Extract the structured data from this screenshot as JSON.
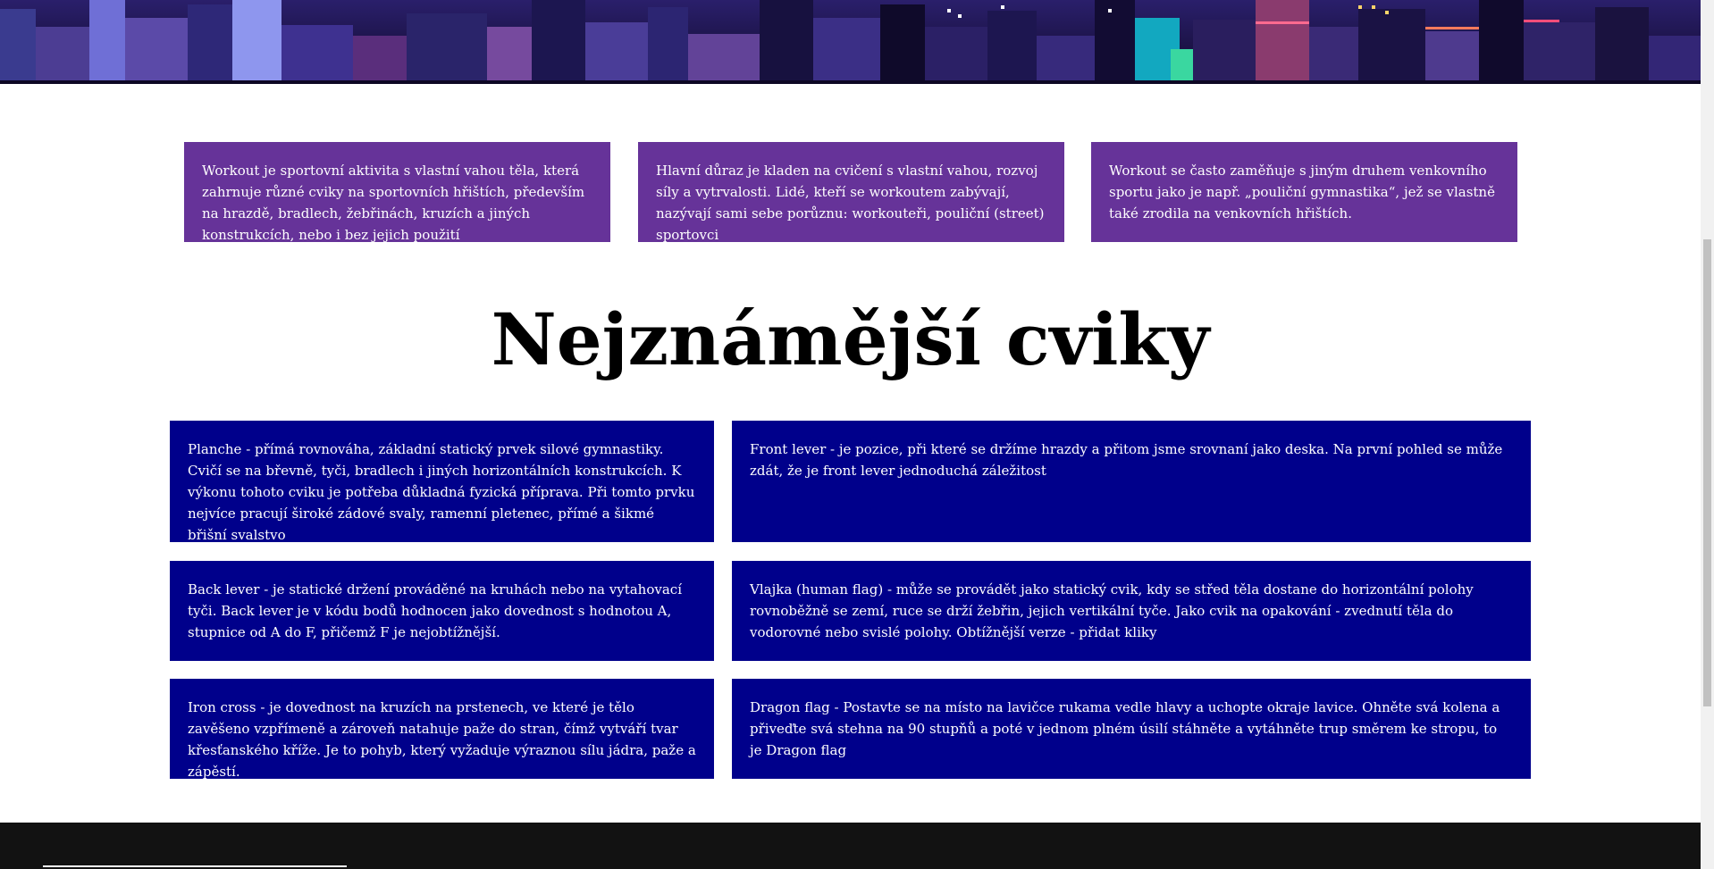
{
  "intro_cards": [
    {
      "text": "Workout je sportovní aktivita s vlastní vahou těla, která zahrnuje různé cviky na sportovních hřištích, především na hrazdě, bradlech, žebřinách, kruzích a jiných konstrukcích, nebo i bez jejich použití"
    },
    {
      "text": "Hlavní důraz je kladen na cvičení s vlastní vahou, rozvoj síly a vytrvalosti. Lidé, kteří se workoutem zabývají, nazývají sami sebe porůznu: workouteři, pouliční (street) sportovci"
    },
    {
      "text": "Workout se často zaměňuje s jiným druhem venkovního sportu jako je např. „pouliční gymnastika“, jež se vlastně také zrodila na venkovních hřištích."
    }
  ],
  "heading": "Nejznámější cviky",
  "exercises": [
    {
      "text": "Planche - přímá rovnováha, základní statický prvek silové gymnastiky. Cvičí se na břevně, tyči, bradlech i jiných horizontálních konstrukcích. K výkonu tohoto cviku je potřeba důkladná fyzická příprava. Při tomto prvku nejvíce pracují široké zádové svaly, ramenní pletenec, přímé a šikmé břišní svalstvo"
    },
    {
      "text": "Front lever - je pozice, při které se držíme hrazdy a přitom jsme srovnaní jako deska. Na první pohled se může zdát, že je front lever jednoduchá záležitost"
    },
    {
      "text": "Back lever - je statické držení prováděné na kruhách nebo na vytahovací tyči. Back lever je v kódu bodů hodnocen jako dovednost s hodnotou A, stupnice od A do F, přičemž F je nejobtížnější."
    },
    {
      "text": "Vlajka (human flag) - může se provádět jako statický cvik, kdy se střed těla dostane do horizontální polohy rovnoběžně se zemí, ruce se drží žebřin, jejich vertikální tyče. Jako cvik na opakování - zvednutí těla do vodorovné nebo svislé polohy. Obtížnější verze - přidat kliky"
    },
    {
      "text": "Iron cross - je dovednost na kruzích na prstenech, ve které je tělo zavěšeno vzpřímeně a zároveň natahuje paže do stran, čímž vytváří tvar křesťanského kříže. Je to pohyb, který vyžaduje výraznou sílu jádra, paže a zápěstí."
    },
    {
      "text": "Dragon flag - Postavte se na místo na lavičce rukama vedle hlavy a uchopte okraje lavice. Ohněte svá kolena a přiveďte svá stehna na 90 stupňů a poté v jednom plném úsilí stáhněte a vytáhněte trup směrem ke stropu, to je Dragon flag"
    }
  ],
  "colors": {
    "intro_card_bg": "#663399",
    "exercise_card_bg": "#00008b",
    "footer_bg": "#121212"
  }
}
